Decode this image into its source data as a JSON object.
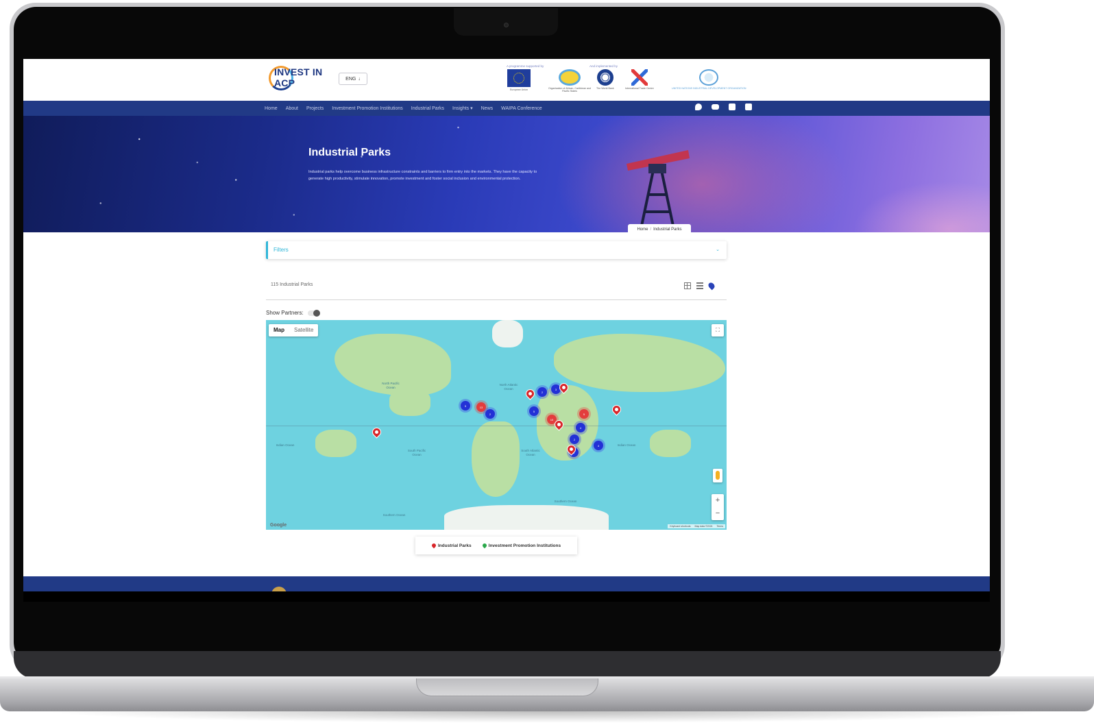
{
  "header": {
    "logo_text": "INVEST IN ACP",
    "language": "ENG",
    "supported_caption": "A programme supported by",
    "implemented_caption": "And implemented by",
    "sponsors": [
      {
        "name": "European Union",
        "icon": "eu-flag-icon"
      },
      {
        "name": "Organisation of African, Caribbean and Pacific States",
        "icon": "oacps-logo-icon"
      },
      {
        "name": "The World Bank",
        "icon": "world-bank-logo-icon"
      },
      {
        "name": "International Trade Centre",
        "icon": "itc-logo-icon"
      },
      {
        "name": "UNITED NATIONS INDUSTRIAL DEVELOPMENT ORGANIZATION",
        "icon": "unido-logo-icon"
      }
    ]
  },
  "nav": {
    "items": [
      "Home",
      "About",
      "Projects",
      "Investment Promotion Institutions",
      "Industrial Parks",
      "Insights",
      "News",
      "WAIPA Conference"
    ],
    "social": [
      "twitter-icon",
      "youtube-icon",
      "facebook-icon",
      "linkedin-icon"
    ]
  },
  "hero": {
    "title": "Industrial Parks",
    "description": "Industrial parks help overcome business infrastructure constraints and barriers to firm entry into the markets. They have the capacity to generate high productivity, stimulate innovation, promote investment and foster social inclusion and environmental protection.",
    "breadcrumb": [
      "Home",
      "Industrial Parks"
    ]
  },
  "filters": {
    "label": "Filters"
  },
  "results": {
    "count_label": "115 Industrial Parks",
    "views": [
      "grid-view-icon",
      "list-view-icon",
      "map-view-icon"
    ]
  },
  "partners": {
    "label": "Show Partners:"
  },
  "map": {
    "types": [
      "Map",
      "Satellite"
    ],
    "ocean_labels": [
      "North Pacific Ocean",
      "North Atlantic Ocean",
      "South Pacific Ocean",
      "South Atlantic Ocean",
      "Indian Ocean",
      "Indian Ocean",
      "Southern Ocean",
      "Southern Ocean"
    ],
    "attribution": [
      "Keyboard shortcuts",
      "Map data ©2024",
      "Terms"
    ],
    "brand": "Google",
    "zoom_in": "+",
    "zoom_out": "−",
    "clusters": [
      {
        "label": "5",
        "color": "blue"
      },
      {
        "label": "13",
        "color": "red"
      },
      {
        "label": "2",
        "color": "blue"
      },
      {
        "label": "2",
        "color": "blue"
      },
      {
        "label": "3",
        "color": "blue"
      },
      {
        "label": "5",
        "color": "blue"
      },
      {
        "label": "10",
        "color": "red"
      },
      {
        "label": "5",
        "color": "red"
      },
      {
        "label": "4",
        "color": "blue"
      },
      {
        "label": "2",
        "color": "blue"
      },
      {
        "label": "4",
        "color": "blue"
      },
      {
        "label": "6",
        "color": "blue"
      }
    ]
  },
  "legend": {
    "items": [
      "Industrial Parks",
      "Investment Promotion Institutions"
    ]
  },
  "colors": {
    "nav": "#213a86",
    "accent": "#2fb6d8",
    "cluster_blue": "#2331d6",
    "cluster_red": "#e33d3d",
    "ocean": "#6ed2e0",
    "land": "#b9dfa4"
  }
}
